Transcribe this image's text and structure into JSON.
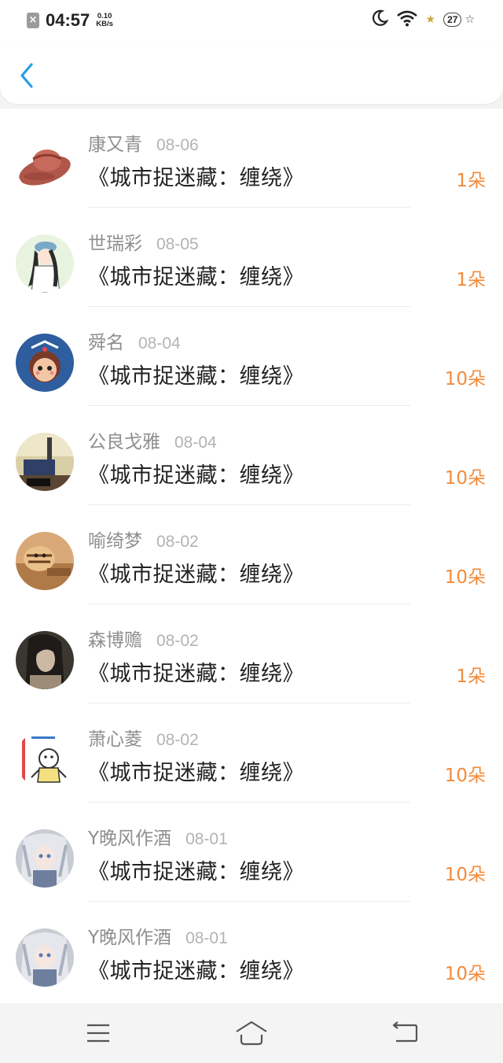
{
  "status_bar": {
    "time": "04:57",
    "speed_value": "0.10",
    "speed_unit": "KB/s",
    "battery": "27"
  },
  "items": [
    {
      "name": "康又青",
      "date": "08-06",
      "work": "《城市捉迷藏：缠绕》",
      "count": "1朵",
      "avatar": "cowboy-hat"
    },
    {
      "name": "世瑞彩",
      "date": "08-05",
      "work": "《城市捉迷藏：缠绕》",
      "count": "1朵",
      "avatar": "cartoon-girl"
    },
    {
      "name": "舜名",
      "date": "08-04",
      "work": "《城市捉迷藏：缠绕》",
      "count": "10朵",
      "avatar": "cartoon-face"
    },
    {
      "name": "公良戈雅",
      "date": "08-04",
      "work": "《城市捉迷藏：缠绕》",
      "count": "10朵",
      "avatar": "room-photo"
    },
    {
      "name": "喻绮梦",
      "date": "08-02",
      "work": "《城市捉迷藏：缠绕》",
      "count": "10朵",
      "avatar": "tiger-toy"
    },
    {
      "name": "森博赡",
      "date": "08-02",
      "work": "《城市捉迷藏：缠绕》",
      "count": "1朵",
      "avatar": "dark-portrait"
    },
    {
      "name": "萧心菱",
      "date": "08-02",
      "work": "《城市捉迷藏：缠绕》",
      "count": "10朵",
      "avatar": "doodle-character"
    },
    {
      "name": "Y晚风作酒",
      "date": "08-01",
      "work": "《城市捉迷藏：缠绕》",
      "count": "10朵",
      "avatar": "anime-girl"
    },
    {
      "name": "Y晚风作酒",
      "date": "08-01",
      "work": "《城市捉迷藏：缠绕》",
      "count": "10朵",
      "avatar": "anime-girl"
    }
  ],
  "colors": {
    "accent": "#2b9de4",
    "count": "#f28b3b",
    "name": "#8e8e8e",
    "date": "#b3b3b3"
  }
}
